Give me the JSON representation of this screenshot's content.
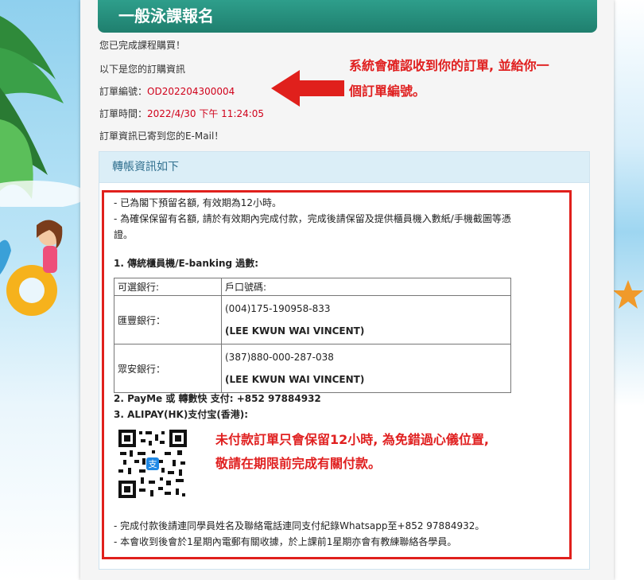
{
  "header": {
    "title": "一般泳課報名"
  },
  "messages": {
    "complete": "您已完成課程購買！",
    "info_intro": "以下是您的訂購資訊",
    "order_no_label": "訂單編號：",
    "order_no": "OD202204300004",
    "order_time_label": "訂單時間：",
    "order_time": "2022/4/30 下午 11:24:05",
    "email_sent": "訂單資訊已寄到您的E-Mail！"
  },
  "annotations": {
    "order_note_1": "系統會確認收到你的訂單, 並給你一",
    "order_note_2": "個訂單編號。",
    "payment_note_1": "未付款訂單只會保留12小時, 為免錯過心儀位置,",
    "payment_note_2": "敬請在期限前完成有關付款。"
  },
  "panel": {
    "heading": "轉帳資訊如下",
    "notes": [
      "- 已為閣下預留名額, 有效期為12小時。",
      "- 為確保保留有名額, 請於有效期內完成付款，完成後請保留及提供櫃員機入數紙/手機截圖等憑",
      "證。"
    ],
    "method_1": "1. 傳統櫃員機/E-banking 過數:",
    "table": {
      "col_bank": "可選銀行:",
      "col_account": "戶口號碼:",
      "rows": [
        {
          "bank": "匯豐銀行：",
          "account": "(004)175-190958-833",
          "name": "(LEE KWUN WAI VINCENT)"
        },
        {
          "bank": "眾安銀行：",
          "account": "(387)880-000-287-038",
          "name": "(LEE KWUN WAI VINCENT)"
        }
      ]
    },
    "method_2": "2. PayMe 或 轉數快 支付: +852 97884932",
    "method_3": "3. ALIPAY(HK)支付宝(香港):",
    "footer_1": "- 完成付款後請連同學員姓名及聯絡電話連同支付紀錄Whatsapp至+852 97884932。",
    "footer_2": "- 本會收到後會於1星期內電郵有關收據，於上課前1星期亦會有教練聯絡各學員。"
  },
  "colors": {
    "title_bg": "#1f7f6e",
    "accent_red": "#e02020",
    "panel_head": "#dbeef7"
  },
  "icons": {
    "qr": "alipay-qr-code-icon",
    "arrow": "left-arrow-icon"
  }
}
